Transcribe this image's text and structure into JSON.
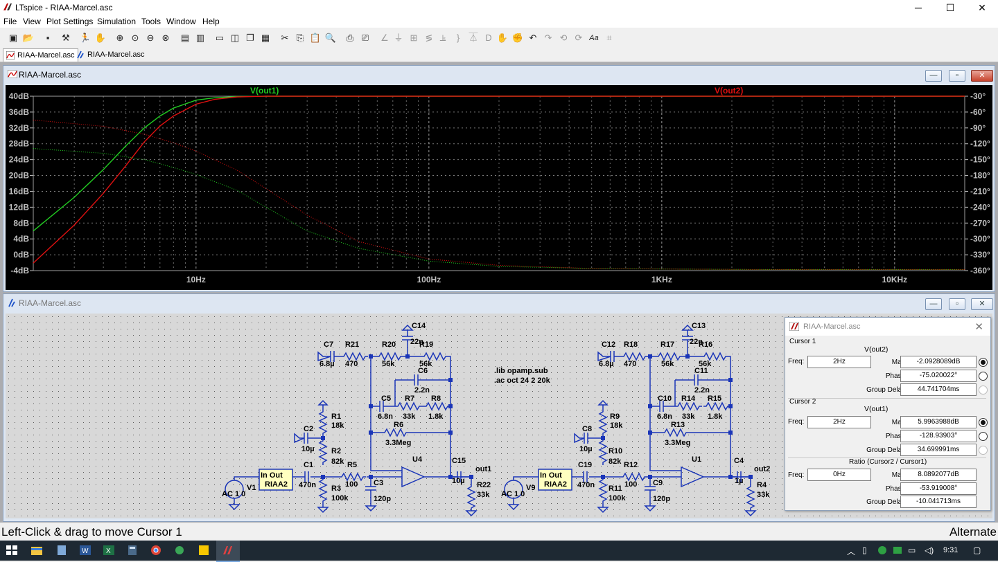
{
  "app": {
    "title": "LTspice - RIAA-Marcel.asc",
    "window_controls": {
      "minimize": "─",
      "maximize": "☐",
      "close": "✕"
    }
  },
  "menu": [
    "File",
    "View",
    "Plot Settings",
    "Simulation",
    "Tools",
    "Window",
    "Help"
  ],
  "tabs": [
    {
      "label": "RIAA-Marcel.asc",
      "icon": "waveform-icon",
      "active": true
    },
    {
      "label": "RIAA-Marcel.asc",
      "icon": "schematic-icon",
      "active": false
    }
  ],
  "plot_window": {
    "title": "RIAA-Marcel.asc",
    "controls": {
      "minimize": "—",
      "maximize": "▫",
      "close": "✕"
    },
    "trace1_label": "V(out1)",
    "trace2_label": "V(out2)",
    "colors": {
      "trace1": "#22cc22",
      "trace2": "#e01010",
      "axis": "#c0c0c0",
      "background": "#000000"
    }
  },
  "chart_data": {
    "type": "line",
    "x_scale": "log",
    "xlim": [
      2,
      20000
    ],
    "x_ticks": [
      {
        "value": 10,
        "label": "10Hz"
      },
      {
        "value": 100,
        "label": "100Hz"
      },
      {
        "value": 1000,
        "label": "1KHz"
      },
      {
        "value": 10000,
        "label": "10KHz"
      }
    ],
    "ylim_left": [
      -4,
      40
    ],
    "y_ticks_left": [
      "40dB",
      "36dB",
      "32dB",
      "28dB",
      "24dB",
      "20dB",
      "16dB",
      "12dB",
      "8dB",
      "4dB",
      "0dB",
      "-4dB"
    ],
    "ylim_right": [
      -360,
      -30
    ],
    "y_ticks_right": [
      "-30°",
      "-60°",
      "-90°",
      "-120°",
      "-150°",
      "-180°",
      "-210°",
      "-240°",
      "-270°",
      "-300°",
      "-330°",
      "-360°"
    ],
    "series": [
      {
        "name": "V(out1)",
        "quantity": "magnitude_dB",
        "color": "#22cc22",
        "x": [
          2,
          3,
          4,
          5,
          6,
          7,
          8,
          10,
          12,
          15,
          20,
          30,
          50,
          100,
          300,
          1000,
          3000,
          10000,
          20000
        ],
        "y": [
          6.0,
          14.5,
          21.5,
          27.5,
          32.0,
          35.0,
          37.0,
          39.0,
          39.6,
          39.9,
          40.0,
          40.0,
          40.0,
          40.0,
          40.0,
          40.0,
          40.0,
          40.0,
          40.0
        ]
      },
      {
        "name": "V(out2)",
        "quantity": "magnitude_dB",
        "color": "#e01010",
        "x": [
          2,
          3,
          4,
          5,
          6,
          7,
          8,
          10,
          12,
          15,
          20,
          30,
          50,
          100,
          300,
          1000,
          3000,
          10000,
          20000
        ],
        "y": [
          -2.1,
          7.5,
          15.5,
          22.5,
          28.5,
          32.5,
          35.0,
          38.0,
          39.2,
          39.8,
          40.0,
          40.0,
          40.0,
          40.0,
          40.0,
          40.0,
          40.0,
          40.0,
          40.0
        ]
      },
      {
        "name": "V(out1) phase",
        "quantity": "phase_deg",
        "color": "#22cc22",
        "dotted": true,
        "x": [
          2,
          4,
          6,
          8,
          10,
          15,
          20,
          30,
          50,
          100,
          200,
          500,
          1000,
          3000,
          10000,
          20000
        ],
        "y": [
          -129,
          -138,
          -150,
          -165,
          -178,
          -208,
          -240,
          -285,
          -318,
          -342,
          -352,
          -356,
          -357,
          -358,
          -358,
          -358
        ]
      },
      {
        "name": "V(out2) phase",
        "quantity": "phase_deg",
        "color": "#e01010",
        "dotted": true,
        "x": [
          2,
          4,
          6,
          8,
          10,
          15,
          20,
          30,
          50,
          100,
          200,
          500,
          1000,
          3000,
          10000,
          20000
        ],
        "y": [
          -75,
          -87,
          -102,
          -118,
          -134,
          -170,
          -205,
          -255,
          -305,
          -338,
          -350,
          -356,
          -357,
          -358,
          -358,
          -358
        ]
      }
    ]
  },
  "schematic_window": {
    "title": "RIAA-Marcel.asc",
    "controls": {
      "minimize": "—",
      "maximize": "▫",
      "close": "✕"
    },
    "spice_directives": [
      ".lib opamp.sub",
      ".ac oct 24 2 20k"
    ],
    "components": {
      "R1": "18k",
      "R2": "82k",
      "R3": "100k",
      "R5": "100",
      "R6": "3.3Meg",
      "R7": "33k",
      "R8": "1.8k",
      "R19": "56k",
      "R20": "56k",
      "R21": "470",
      "R22": "33k",
      "C1": "470n",
      "C2": "10µ",
      "C3": "120p",
      "C5": "6.8n",
      "C6": "2.2n",
      "C7": "6.8µ",
      "C14": "22n",
      "C15": "10µ",
      "R9": "18k",
      "R10": "82k",
      "R11": "100k",
      "R12": "100",
      "R13": "3.3Meg",
      "R14": "33k",
      "R15": "1.8k",
      "R16": "56k",
      "R17": "56k",
      "R18": "470",
      "R4": "33k",
      "C8": "10µ",
      "C9": "120p",
      "C10": "6.8n",
      "C11": "2.2n",
      "C12": "6.8µ",
      "C13": "22n",
      "C19": "470n",
      "C4": "1µ",
      "V1": "AC 1 0",
      "V9": "AC 1 0",
      "U4": "U4",
      "U1": "U1",
      "RIAA2": "RIAA2",
      "block_pins": "In  Out",
      "out1": "out1",
      "out2": "out2"
    }
  },
  "cursor_dialog": {
    "title": "RIAA-Marcel.asc",
    "cursor1": {
      "group": "Cursor 1",
      "trace": "V(out2)",
      "freq_label": "Freq:",
      "freq": "2Hz",
      "mag_label": "Mag:",
      "mag": "-2.0928089dB",
      "phase_label": "Phase:",
      "phase": "-75.020022°",
      "gd_label": "Group Delay:",
      "group_delay": "44.741704ms"
    },
    "cursor2": {
      "group": "Cursor 2",
      "trace": "V(out1)",
      "freq_label": "Freq:",
      "freq": "2Hz",
      "mag_label": "Mag:",
      "mag": "5.9963988dB",
      "phase_label": "Phase:",
      "phase": "-128.93903°",
      "gd_label": "Group Delay:",
      "group_delay": "34.699991ms"
    },
    "ratio": {
      "group": "Ratio (Cursor2 / Cursor1)",
      "freq_label": "Freq:",
      "freq": "0Hz",
      "mag_label": "Mag:",
      "mag": "8.0892077dB",
      "phase_label": "Phase:",
      "phase": "-53.919008°",
      "gd_label": "Group Delay:",
      "group_delay": "-10.041713ms"
    }
  },
  "status": {
    "left": "Left-Click & drag to move Cursor 1",
    "right": "Alternate"
  },
  "taskbar": {
    "time": "9:31"
  }
}
